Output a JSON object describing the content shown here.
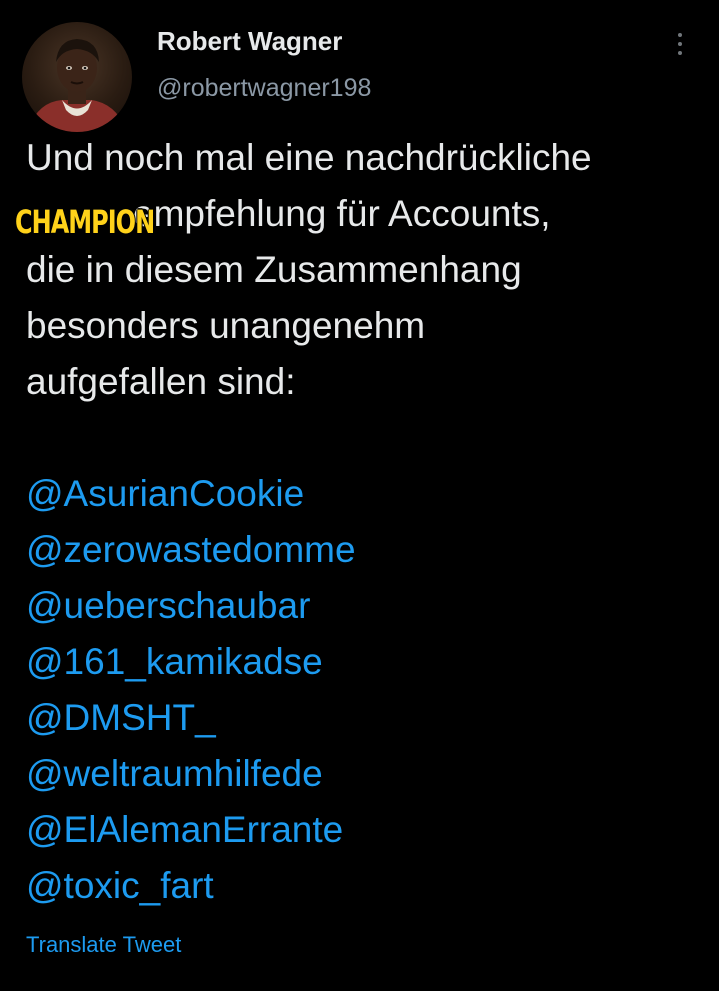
{
  "author": {
    "display_name": "Robert Wagner",
    "handle": "@robertwagner198"
  },
  "tweet": {
    "lines": [
      "Und noch mal eine nachdrückliche",
      "empfehlung für Accounts,",
      "die in diesem Zusammenhang",
      "besonders unangenehm",
      "aufgefallen sind:"
    ],
    "sticker_text": "CHAMPION",
    "mentions": [
      "@AsurianCookie",
      "@zerowastedomme",
      "@ueberschaubar",
      "@161_kamikadse",
      "@DMSHT_",
      "@weltraumhilfede",
      "@ElAlemanErrante",
      "@toxic_fart"
    ],
    "translate_label": "Translate Tweet"
  },
  "icons": {
    "more": "more-vertical-icon",
    "avatar": "portrait-avatar"
  },
  "colors": {
    "background": "#000000",
    "text": "#e7e9ea",
    "muted": "#8b98a5",
    "link": "#1d9bf0",
    "sticker": "#ffd21a"
  }
}
